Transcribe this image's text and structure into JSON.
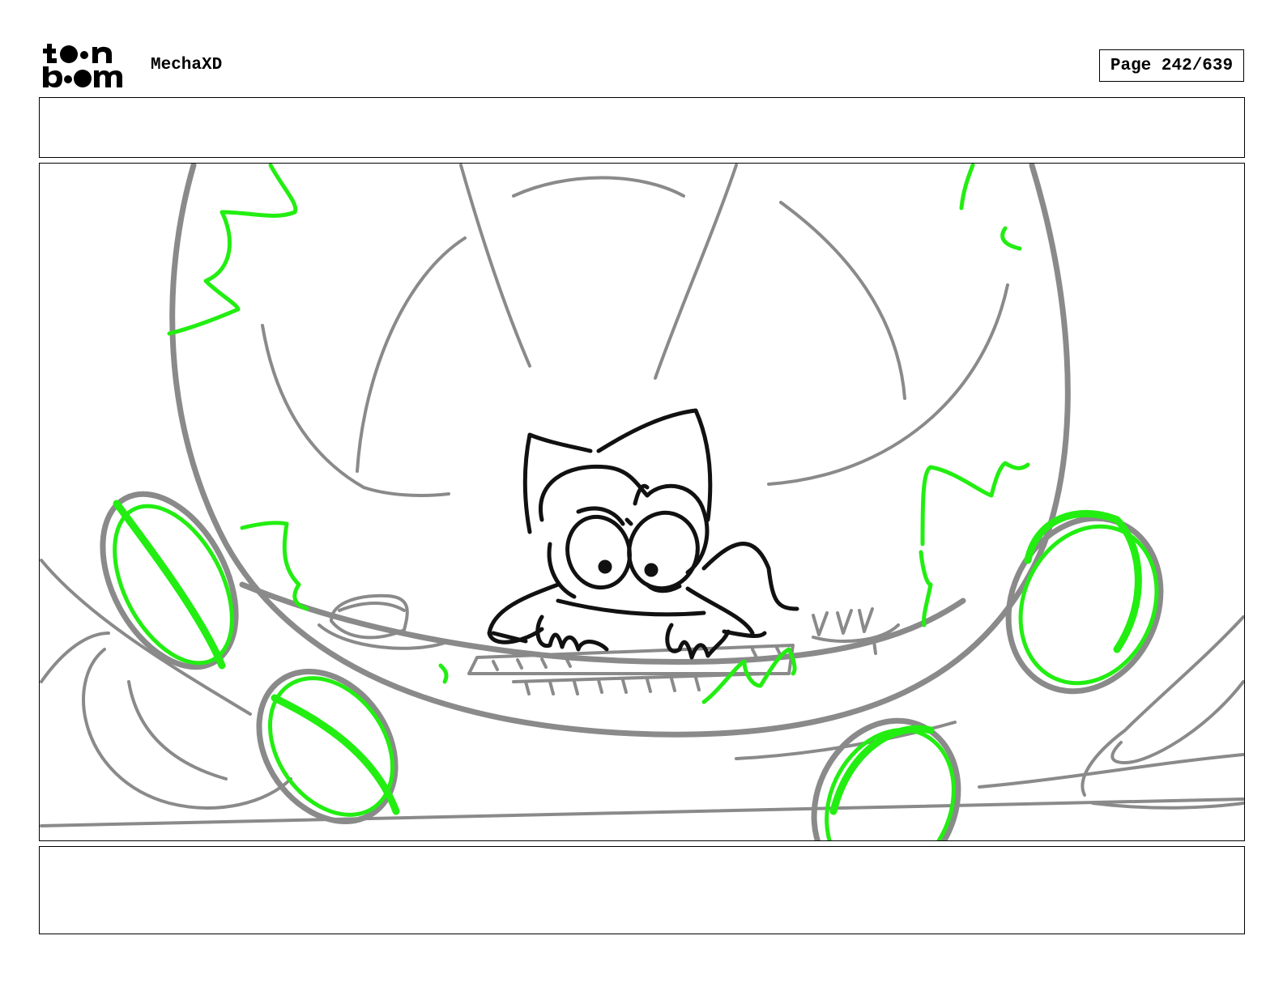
{
  "header": {
    "project_title": "MechaXD",
    "page_label": "Page 242/639"
  },
  "logo": {
    "icon": "toon-boom-logo-icon",
    "line1": "t●●n",
    "line2": "b●●m"
  },
  "panels": {
    "top_caption": "",
    "bottom_caption": ""
  },
  "colors": {
    "sketch_gray": "#8a8a8a",
    "sketch_black": "#111111",
    "energy_green": "#22ee11"
  }
}
